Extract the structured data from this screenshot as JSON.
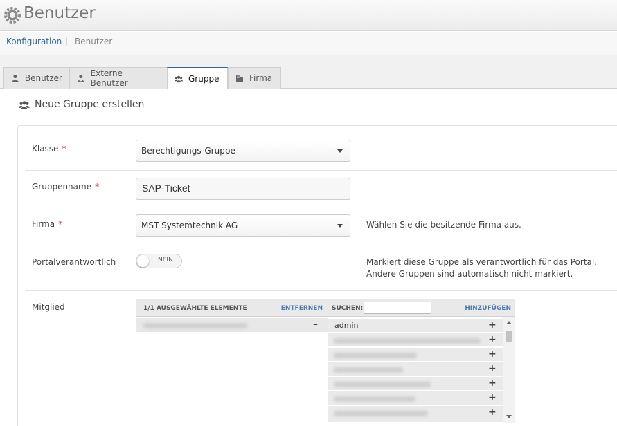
{
  "header": {
    "title": "Benutzer",
    "logo_icon": "gear-icon"
  },
  "breadcrumb": {
    "items": [
      "Konfiguration",
      "Benutzer"
    ],
    "separator": "|"
  },
  "tabs": [
    {
      "label": "Benutzer",
      "icon": "user-icon",
      "active": false
    },
    {
      "label": "Externe Benutzer",
      "icon": "external-user-icon",
      "active": false
    },
    {
      "label": "Gruppe",
      "icon": "users-icon",
      "active": true
    },
    {
      "label": "Firma",
      "icon": "building-icon",
      "active": false
    }
  ],
  "section": {
    "title": "Neue Gruppe erstellen",
    "icon": "users-icon"
  },
  "form": {
    "klasse": {
      "label": "Klasse",
      "required_mark": "*",
      "value": "Berechtigungs-Gruppe"
    },
    "gruppenname": {
      "label": "Gruppenname",
      "required_mark": "*",
      "value": "SAP-Ticket"
    },
    "firma": {
      "label": "Firma",
      "required_mark": "*",
      "value": "MST Systemtechnik AG",
      "hint": "Wählen Sie die besitzende Firma aus."
    },
    "portal": {
      "label": "Portalverantwortlich",
      "toggle_text": "NEIN",
      "enabled": false,
      "hint": "Markiert diese Gruppe als verantwortlich für das Portal. Andere Gruppen sind automatisch nicht markiert."
    },
    "mitglied": {
      "label": "Mitglied",
      "selected_header": "1/1 AUSGEWÄHLTE ELEMENTE",
      "remove_all": "ENTFERNEN",
      "search_label": "SUCHEN:",
      "search_value": "",
      "add_all": "HINZUFÜGEN",
      "remove_symbol": "–",
      "add_symbol": "+",
      "available_first": "admin"
    }
  },
  "colors": {
    "accent": "#2b6a9e",
    "required": "#c0392b",
    "link": "#4a7bb0"
  }
}
